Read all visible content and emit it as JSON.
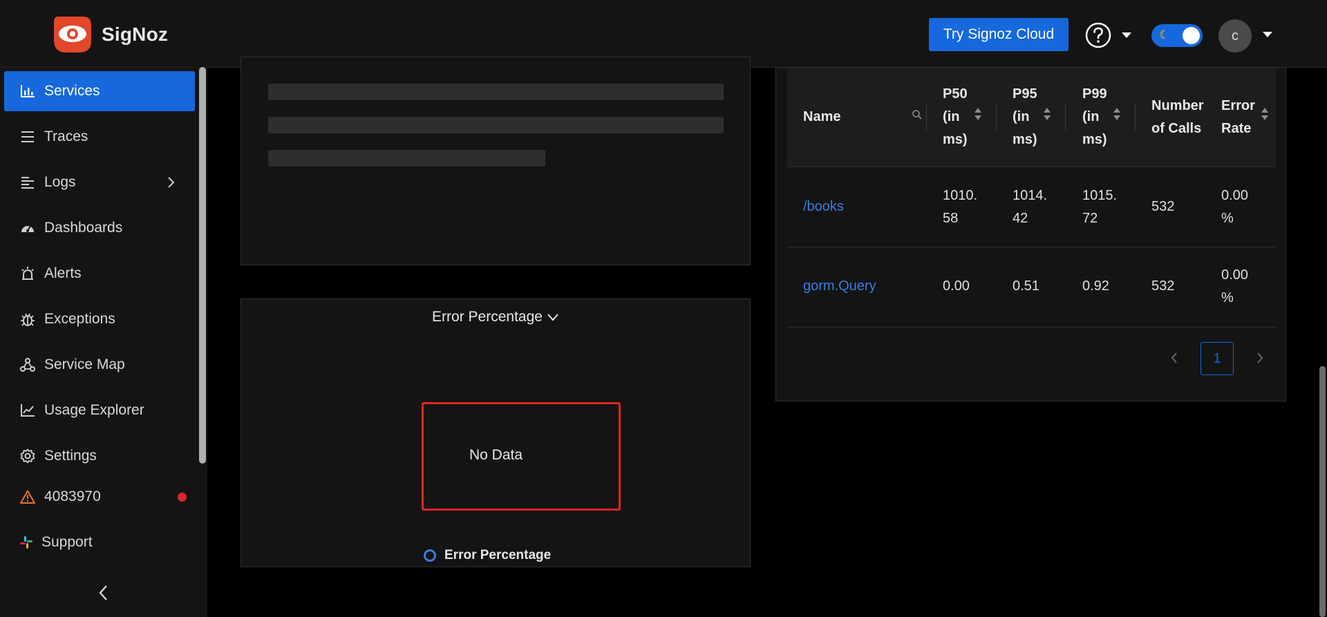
{
  "header": {
    "brand": "SigNoz",
    "try_button": "Try Signoz Cloud",
    "avatar_initial": "c"
  },
  "sidebar": {
    "items": [
      {
        "label": "Services",
        "icon": "bar-chart-icon",
        "active": true
      },
      {
        "label": "Traces",
        "icon": "list-icon"
      },
      {
        "label": "Logs",
        "icon": "logs-icon"
      },
      {
        "label": "Dashboards",
        "icon": "dashboard-icon"
      },
      {
        "label": "Alerts",
        "icon": "alarm-icon"
      },
      {
        "label": "Exceptions",
        "icon": "bug-icon"
      },
      {
        "label": "Service Map",
        "icon": "deployment-icon"
      },
      {
        "label": "Usage Explorer",
        "icon": "line-chart-icon"
      },
      {
        "label": "Settings",
        "icon": "gear-icon"
      },
      {
        "label": "4083970",
        "icon": "warning-icon"
      },
      {
        "label": "Support",
        "icon": "slack-icon"
      }
    ]
  },
  "error_panel": {
    "title": "Error Percentage",
    "no_data": "No Data",
    "legend": "Error Percentage"
  },
  "table": {
    "headers": {
      "name": "Name",
      "p50": [
        "P50",
        "(in",
        "ms)"
      ],
      "p95": [
        "P95",
        "(in",
        "ms)"
      ],
      "p99": [
        "P99",
        "(in",
        "ms)"
      ],
      "calls": [
        "Number",
        "of Calls"
      ],
      "error": [
        "Error",
        "Rate"
      ]
    },
    "rows": [
      {
        "name": "/books",
        "p50": [
          "1010.",
          "58"
        ],
        "p95": [
          "1014.",
          "42"
        ],
        "p99": [
          "1015.",
          "72"
        ],
        "calls": "532",
        "error": [
          "0.00",
          "%"
        ]
      },
      {
        "name": "gorm.Query",
        "p50": [
          "0.00"
        ],
        "p95": [
          "0.51"
        ],
        "p99": [
          "0.92"
        ],
        "calls": "532",
        "error": [
          "0.00",
          "%"
        ]
      }
    ],
    "current_page": "1"
  },
  "colors": {
    "accent": "#1668dc",
    "link": "#3b7de0",
    "alert_red": "#e3261d"
  }
}
